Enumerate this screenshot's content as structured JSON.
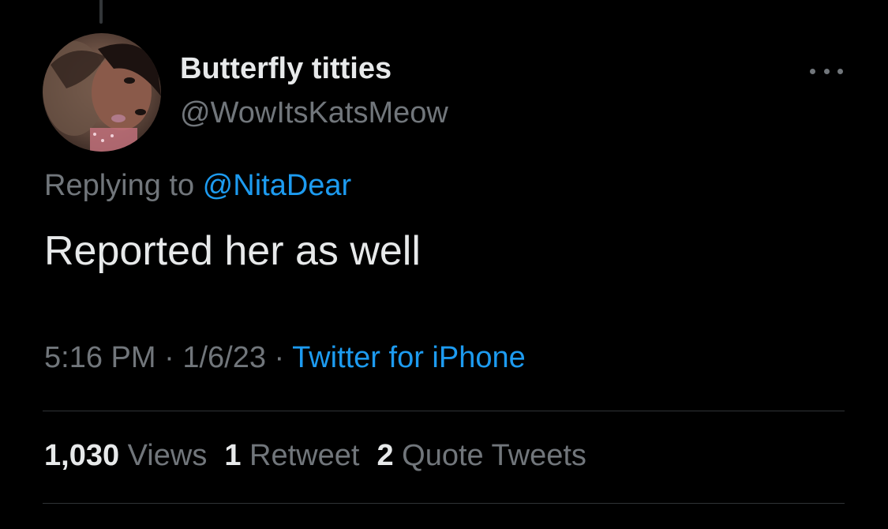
{
  "tweet": {
    "author": {
      "display_name": "Butterfly titties",
      "handle": "@WowItsKatsMeow"
    },
    "replying_to_prefix": "Replying to ",
    "replying_to_handle": "@NitaDear",
    "text": "Reported her as well",
    "time": "5:16 PM",
    "separator": " · ",
    "date": "1/6/23",
    "source": "Twitter for iPhone",
    "stats": {
      "views_count": "1,030",
      "views_label": " Views",
      "retweets_count": "1",
      "retweets_label": " Retweet",
      "quotes_count": "2",
      "quotes_label": " Quote Tweets"
    }
  },
  "icons": {
    "more": "more-horizontal-icon"
  },
  "colors": {
    "background": "#000000",
    "primary_text": "#e7e9ea",
    "secondary_text": "#71767b",
    "link": "#1d9bf0",
    "divider": "#2f3336"
  }
}
